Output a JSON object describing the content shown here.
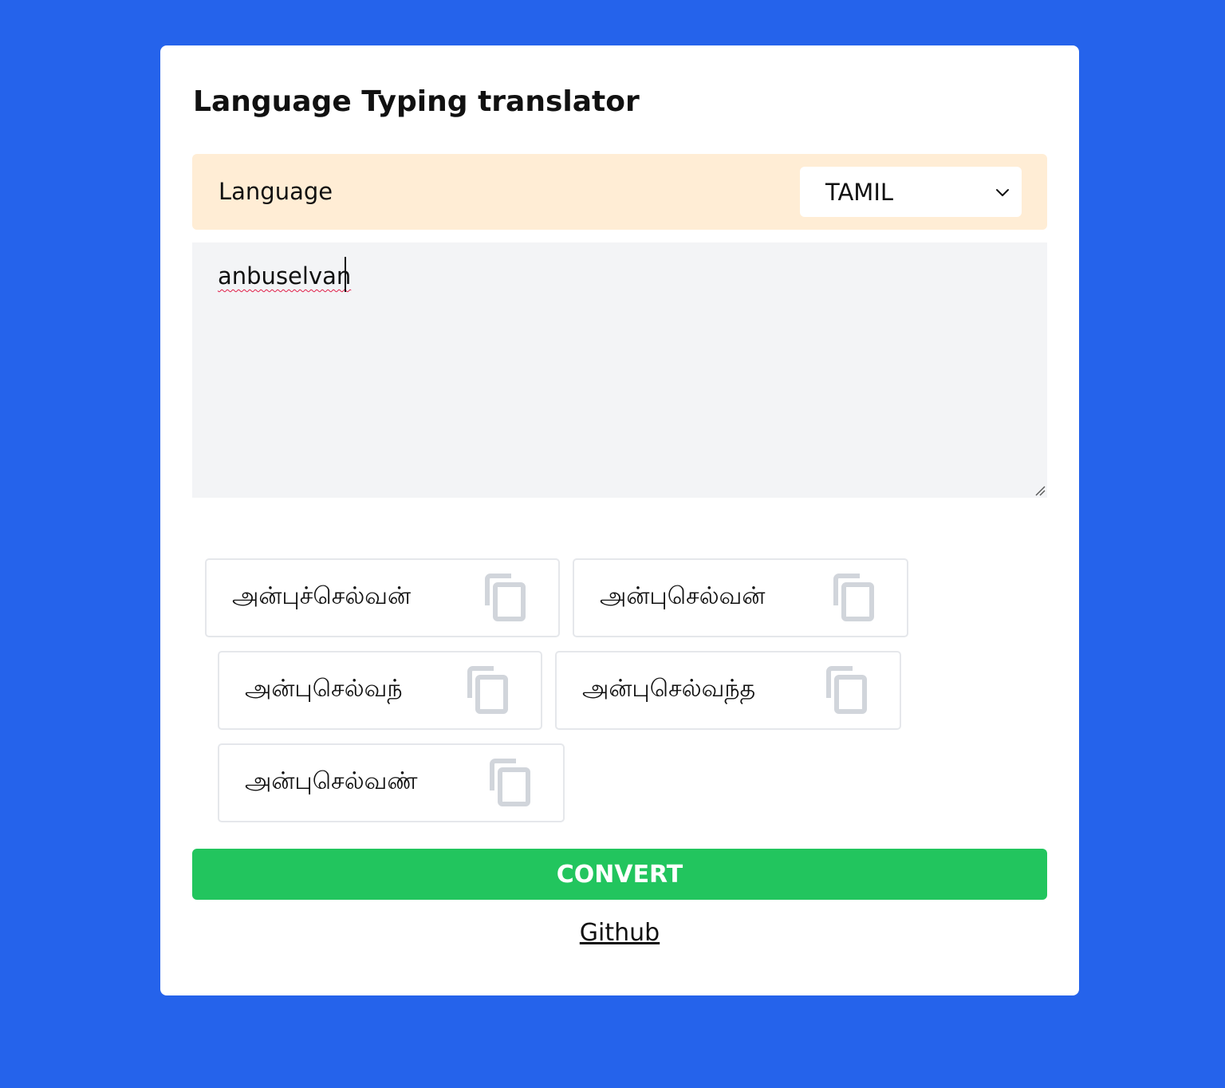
{
  "app": {
    "title": "Language Typing translator"
  },
  "language": {
    "label": "Language",
    "selected": "TAMIL"
  },
  "input": {
    "value": "anbuselvan"
  },
  "suggestions": [
    "அன்புச்செல்வன்",
    "அன்புசெல்வன்",
    "அன்புசெல்வந்",
    "அன்புசெல்வந்த",
    "அன்புசெல்வண்"
  ],
  "actions": {
    "convert_label": "CONVERT",
    "github_label": "Github"
  },
  "icons": {
    "copy": "copy-icon",
    "dropdown": "chevron-down-icon",
    "resize": "resize-handle-icon"
  },
  "colors": {
    "background": "#2563eb",
    "language_row": "#ffedd5",
    "textarea": "#f3f4f6",
    "convert_button": "#22c55e",
    "copy_icon": "#d1d5db"
  }
}
